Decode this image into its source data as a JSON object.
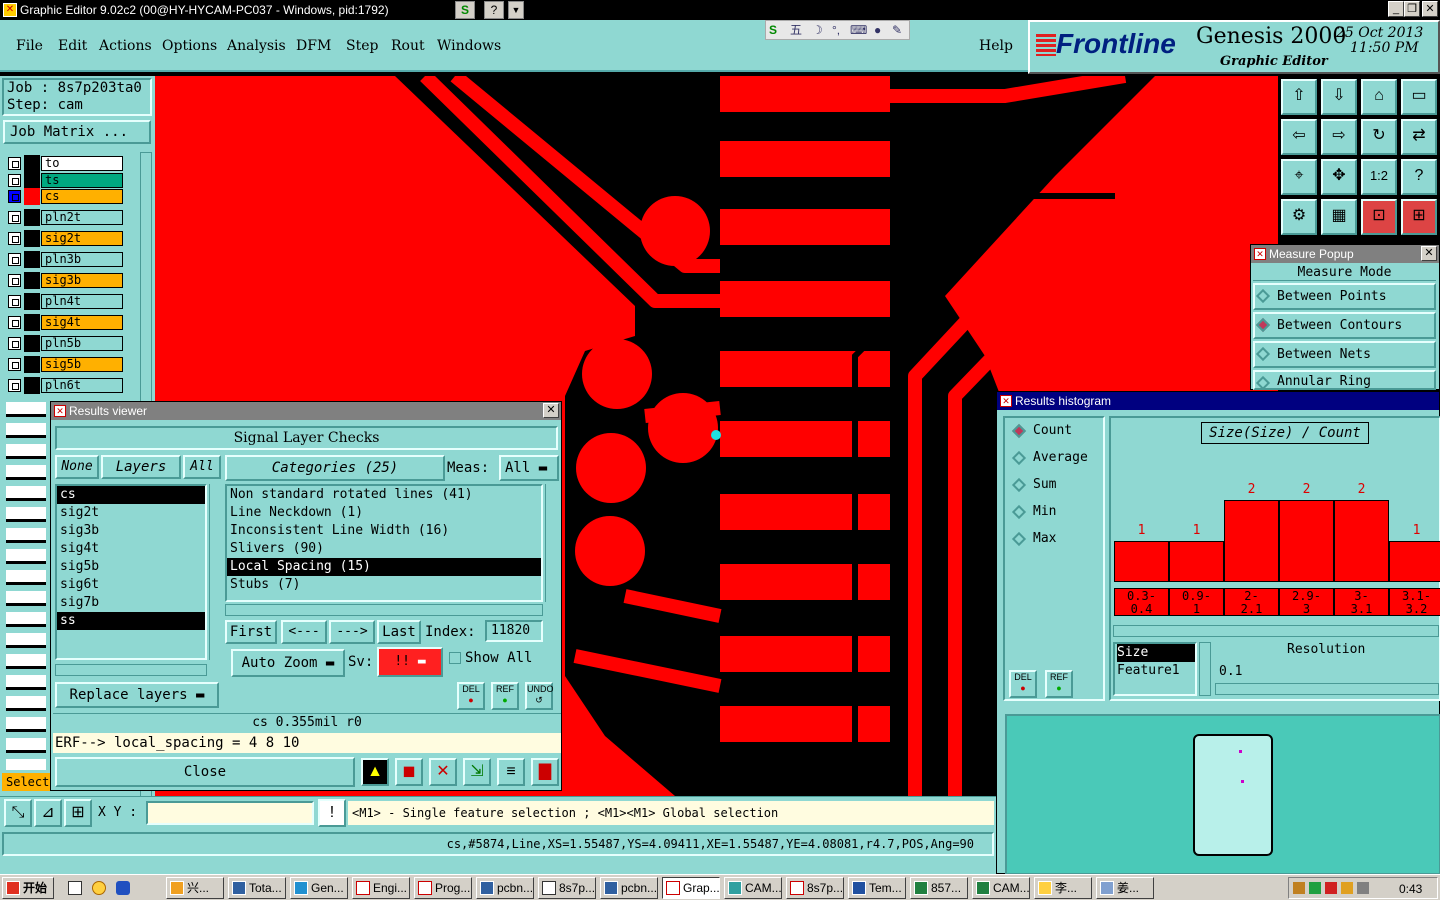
{
  "window": {
    "title": "Graphic Editor 9.02c2 (00@HY-HYCAM-PC037 - Windows, pid:1792)"
  },
  "menu": {
    "items": [
      "File",
      "Edit",
      "Actions",
      "Options",
      "Analysis",
      "DFM",
      "Step",
      "Rout",
      "Windows"
    ],
    "help": "Help"
  },
  "brand": {
    "logo": "Frontline",
    "product": "Genesis 2000",
    "subtitle": "Graphic Editor",
    "date": "25 Oct 2013",
    "time": "11:50 PM"
  },
  "job": {
    "job_label": "Job : 8s7p203ta0",
    "step_label": "Step: cam",
    "matrix_button": "Job Matrix ..."
  },
  "layers": [
    {
      "name": "to",
      "color": "#ffffff",
      "nameBg": "#ffffff"
    },
    {
      "name": "ts",
      "color": "#00a880",
      "nameBg": "#00a880"
    },
    {
      "name": "cs",
      "color": "#ff0000",
      "nameBg": "#ffb000"
    },
    {
      "name": "pln2t",
      "color": "#000000",
      "nameBg": "#8fd8d2"
    },
    {
      "name": "sig2t",
      "color": "#000000",
      "nameBg": "#ffb000"
    },
    {
      "name": "pln3b",
      "color": "#000000",
      "nameBg": "#8fd8d2"
    },
    {
      "name": "sig3b",
      "color": "#000000",
      "nameBg": "#ffb000"
    },
    {
      "name": "pln4t",
      "color": "#000000",
      "nameBg": "#8fd8d2"
    },
    {
      "name": "sig4t",
      "color": "#000000",
      "nameBg": "#ffb000"
    },
    {
      "name": "pln5b",
      "color": "#000000",
      "nameBg": "#8fd8d2"
    },
    {
      "name": "sig5b",
      "color": "#000000",
      "nameBg": "#ffb000"
    },
    {
      "name": "pln6t",
      "color": "#000000",
      "nameBg": "#8fd8d2"
    }
  ],
  "select_label": "Select",
  "results_viewer": {
    "title": "Results viewer",
    "header": "Signal Layer Checks",
    "none_btn": "None",
    "layers_btn": "Layers",
    "all_btn": "All",
    "layer_list": [
      "cs",
      "sig2t",
      "sig3b",
      "sig4t",
      "sig5b",
      "sig6t",
      "sig7b",
      "ss"
    ],
    "categories_btn": "Categories (25)",
    "meas_label": "Meas:",
    "meas_value": "All",
    "categories": [
      "Non standard rotated lines (41)",
      "Line Neckdown (1)",
      "Inconsistent Line Width (16)",
      "Slivers (90)",
      "Local Spacing (15)",
      "Stubs (7)"
    ],
    "selected_category": "Local Spacing (15)",
    "first_btn": "First",
    "prev_btn": "<---",
    "next_btn": "--->",
    "last_btn": "Last",
    "index_label": "Index:",
    "index_value": "11820",
    "auto_zoom": "Auto Zoom",
    "sv_label": "Sv:",
    "sv_value": "!!",
    "show_all": "Show All",
    "replace_layers": "Replace layers",
    "del": "DEL",
    "ref": "REF",
    "undo": "UNDO",
    "status": "cs 0.355mil  r0",
    "erf": "ERF--> local_spacing = 4 8 10",
    "close": "Close"
  },
  "measure_popup": {
    "title": "Measure Popup",
    "mode_label": "Measure Mode",
    "options": [
      "Between Points",
      "Between Contours",
      "Between Nets",
      "Annular Ring"
    ],
    "selected": "Between Contours"
  },
  "histogram": {
    "title": "Results histogram",
    "modes": [
      "Count",
      "Average",
      "Sum",
      "Min",
      "Max"
    ],
    "selected_mode": "Count",
    "chart_title": "Size(Size) / Count",
    "del": "DEL",
    "ref": "REF",
    "size_label": "Size",
    "feature_label": "Feature1",
    "resolution_label": "Resolution",
    "resolution_value": "0.1"
  },
  "chart_data": {
    "type": "bar",
    "title": "Size(Size) / Count",
    "categories": [
      "0.3-0.4",
      "0.9-1",
      "2-2.1",
      "2.9-3",
      "3-3.1",
      "3.1-3.2"
    ],
    "category_labels": [
      [
        "0.3-",
        "0.4"
      ],
      [
        "0.9-",
        "1"
      ],
      [
        "2-",
        "2.1"
      ],
      [
        "2.9-",
        "3"
      ],
      [
        "3-",
        "3.1"
      ],
      [
        "3.1-",
        "3.2"
      ]
    ],
    "values": [
      1,
      1,
      2,
      2,
      2,
      1
    ],
    "ylim": [
      0,
      2
    ]
  },
  "bottom": {
    "xy_label": "X Y :",
    "xy_value": "",
    "hint": "<M1> - Single feature selection ; <M1><M1> Global selection",
    "feature_info": "cs,#5874,Line,XS=1.55487,YS=4.09411,XE=1.55487,YE=4.08081,r4.7,POS,Ang=90"
  },
  "taskbar": {
    "start": "开始",
    "tasks": [
      "兴...",
      "Tota...",
      "Gen...",
      "Engi...",
      "Prog...",
      "pcbn...",
      "8s7p...",
      "pcbn...",
      "Grap...",
      "CAM...",
      "8s7p...",
      "Tem...",
      "857...",
      "CAM...",
      "李...",
      "姜..."
    ],
    "active": "Grap...",
    "clock": "0:43"
  },
  "colors": {
    "panel": "#8fd8d2",
    "copper": "#ff0000",
    "selection": "#000000"
  }
}
